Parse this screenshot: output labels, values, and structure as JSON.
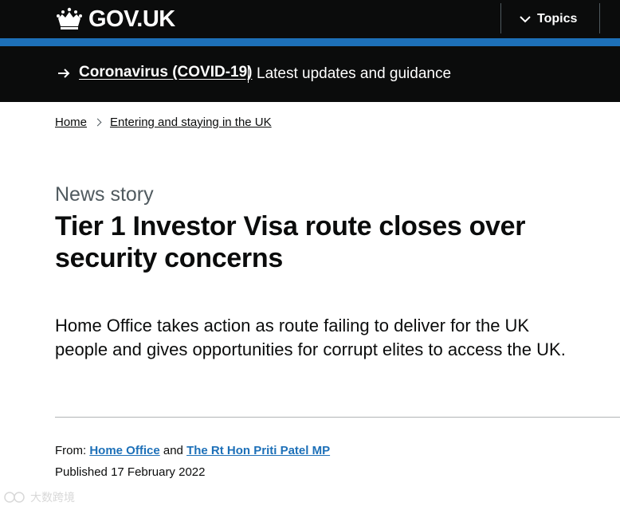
{
  "header": {
    "logo_text": "GOV.UK",
    "topics_label": "Topics",
    "crown_icon": "crown-icon",
    "chevron_icon": "chevron-down-icon"
  },
  "covid_banner": {
    "link_text": "Coronavirus (COVID-19)",
    "description": "Latest updates and guidance",
    "arrow_icon": "arrow-right-icon"
  },
  "breadcrumb": {
    "items": [
      "Home",
      "Entering and staying in the UK"
    ]
  },
  "article": {
    "caption": "News story",
    "title": "Tier 1 Investor Visa route closes over security concerns",
    "lead": "Home Office takes action as route failing to deliver for the UK people and gives opportunities for corrupt elites to access the UK."
  },
  "metadata": {
    "from_label": "From:",
    "from_org": "Home Office",
    "and_text": "and",
    "from_person": "The Rt Hon Priti Patel MP",
    "published_label": "Published",
    "published_date": "17 February 2022"
  },
  "watermark": {
    "text": "大数跨境"
  },
  "colors": {
    "header_bg": "#0b0c0c",
    "brand_blue": "#1d70b8",
    "secondary_text": "#505a5f",
    "divider": "#b1b4b6"
  }
}
